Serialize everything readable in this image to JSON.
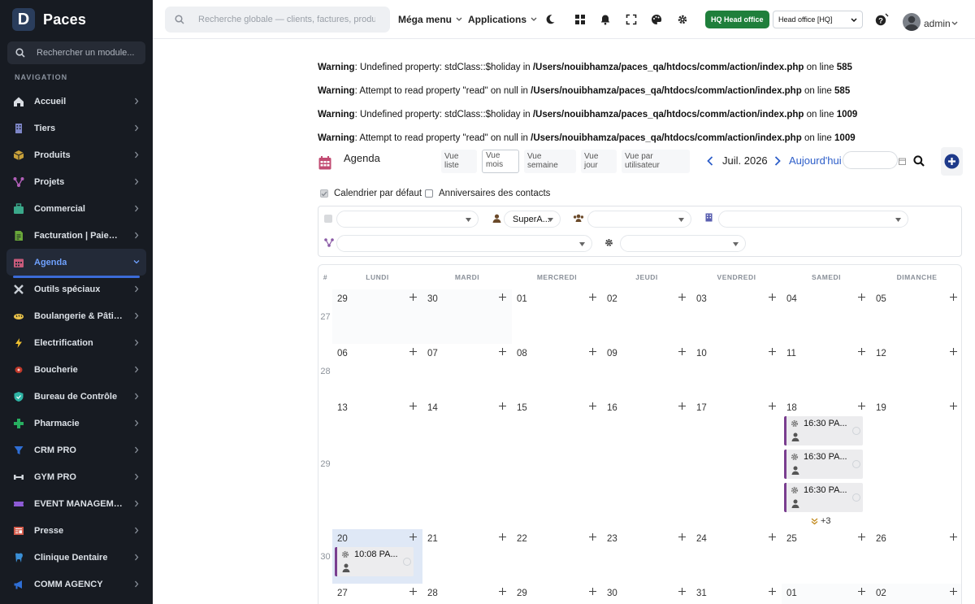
{
  "brand": {
    "logo_letter": "D",
    "name": "Paces"
  },
  "sidebar": {
    "search_placeholder": "Rechercher un module...",
    "heading": "NAVIGATION",
    "items": [
      {
        "label": "Accueil",
        "icon": "home-icon",
        "color": "#d9dde3"
      },
      {
        "label": "Tiers",
        "icon": "building-icon",
        "color": "#7d86c7"
      },
      {
        "label": "Produits",
        "icon": "box-icon",
        "color": "#c7a03a"
      },
      {
        "label": "Projets",
        "icon": "project-icon",
        "color": "#b15fb8"
      },
      {
        "label": "Commercial",
        "icon": "commercial-icon",
        "color": "#3aa88a"
      },
      {
        "label": "Facturation | Paiement",
        "icon": "invoice-icon",
        "color": "#6aa83a"
      },
      {
        "label": "Agenda",
        "icon": "calendar-icon",
        "color": "#c75a7a",
        "active": true
      },
      {
        "label": "Outils spéciaux",
        "icon": "tools-icon",
        "color": "#c9ced6"
      },
      {
        "label": "Boulangerie & Pâtisserie",
        "icon": "bread-icon",
        "color": "#e8c14a"
      },
      {
        "label": "Electrification",
        "icon": "bolt-icon",
        "color": "#f2c230"
      },
      {
        "label": "Boucherie",
        "icon": "meat-icon",
        "color": "#c0392b"
      },
      {
        "label": "Bureau de Contrôle",
        "icon": "shield-icon",
        "color": "#2fb5a6"
      },
      {
        "label": "Pharmacie",
        "icon": "cross-icon",
        "color": "#27ae60"
      },
      {
        "label": "CRM PRO",
        "icon": "funnel-icon",
        "color": "#2f6fd6"
      },
      {
        "label": "GYM PRO",
        "icon": "dumbbell-icon",
        "color": "#cfd4da"
      },
      {
        "label": "EVENT MANAGEMENT",
        "icon": "ticket-icon",
        "color": "#8e5bd6"
      },
      {
        "label": "Presse",
        "icon": "newspaper-icon",
        "color": "#d45b4b"
      },
      {
        "label": "Clinique Dentaire",
        "icon": "tooth-icon",
        "color": "#3a8fd6"
      },
      {
        "label": "COMM AGENCY",
        "icon": "megaphone-icon",
        "color": "#2f6fd6"
      }
    ]
  },
  "topbar": {
    "search_placeholder": "Recherche globale — clients, factures, produits...",
    "mega_menu": "Méga menu",
    "applications": "Applications",
    "hq_badge": "HQ Head office",
    "entity": "Head office [HQ]",
    "user": "admin"
  },
  "warnings": [
    {
      "label": "Warning",
      "text": ": Undefined property: stdClass::$holiday in ",
      "file": "/Users/nouibhamza/paces_qa/htdocs/comm/action/index.php",
      "on_line": " on line ",
      "line": "585"
    },
    {
      "label": "Warning",
      "text": ": Attempt to read property \"read\" on null in ",
      "file": "/Users/nouibhamza/paces_qa/htdocs/comm/action/index.php",
      "on_line": " on line ",
      "line": "585"
    },
    {
      "label": "Warning",
      "text": ": Undefined property: stdClass::$holiday in ",
      "file": "/Users/nouibhamza/paces_qa/htdocs/comm/action/index.php",
      "on_line": " on line ",
      "line": "1009"
    },
    {
      "label": "Warning",
      "text": ": Attempt to read property \"read\" on null in ",
      "file": "/Users/nouibhamza/paces_qa/htdocs/comm/action/index.php",
      "on_line": " on line ",
      "line": "1009"
    }
  ],
  "agenda": {
    "title": "Agenda",
    "views": [
      {
        "label": "Vue liste",
        "active": false
      },
      {
        "label": "Vue mois",
        "active": true
      },
      {
        "label": "Vue semaine",
        "active": false
      },
      {
        "label": "Vue jour",
        "active": false
      },
      {
        "label": "Vue par utilisateur",
        "active": false
      }
    ],
    "month": "Juil. 2026",
    "today": "Aujourd'hui",
    "checkbox_default": "Calendrier par défaut",
    "checkbox_birthdays": "Anniversaires des contacts",
    "filters": {
      "user": "SuperA..."
    }
  },
  "calendar": {
    "week_col": "#",
    "days": [
      "LUNDI",
      "MARDI",
      "MERCREDI",
      "JEUDI",
      "VENDREDI",
      "SAMEDI",
      "DIMANCHE"
    ],
    "weeks": [
      {
        "num": "27",
        "dates": [
          "29",
          "30",
          "01",
          "02",
          "03",
          "04",
          "05"
        ],
        "other": [
          0,
          1
        ]
      },
      {
        "num": "28",
        "dates": [
          "06",
          "07",
          "08",
          "09",
          "10",
          "11",
          "12"
        ],
        "other": []
      },
      {
        "num": "29",
        "dates": [
          "13",
          "14",
          "15",
          "16",
          "17",
          "18",
          "19"
        ],
        "other": []
      },
      {
        "num": "30",
        "dates": [
          "20",
          "21",
          "22",
          "23",
          "24",
          "25",
          "26"
        ],
        "other": [],
        "today": 0
      },
      {
        "num": "31",
        "dates": [
          "27",
          "28",
          "29",
          "30",
          "31",
          "01",
          "02"
        ],
        "other": [
          5,
          6
        ]
      }
    ],
    "events": [
      {
        "week": 2,
        "day": 5,
        "time": "16:30 PA..."
      },
      {
        "week": 2,
        "day": 5,
        "time": "16:30 PA..."
      },
      {
        "week": 2,
        "day": 5,
        "time": "16:30 PA..."
      },
      {
        "week": 3,
        "day": 0,
        "time": "10:08 PA..."
      }
    ],
    "more": {
      "week": 2,
      "day": 5,
      "label": "+3"
    }
  }
}
